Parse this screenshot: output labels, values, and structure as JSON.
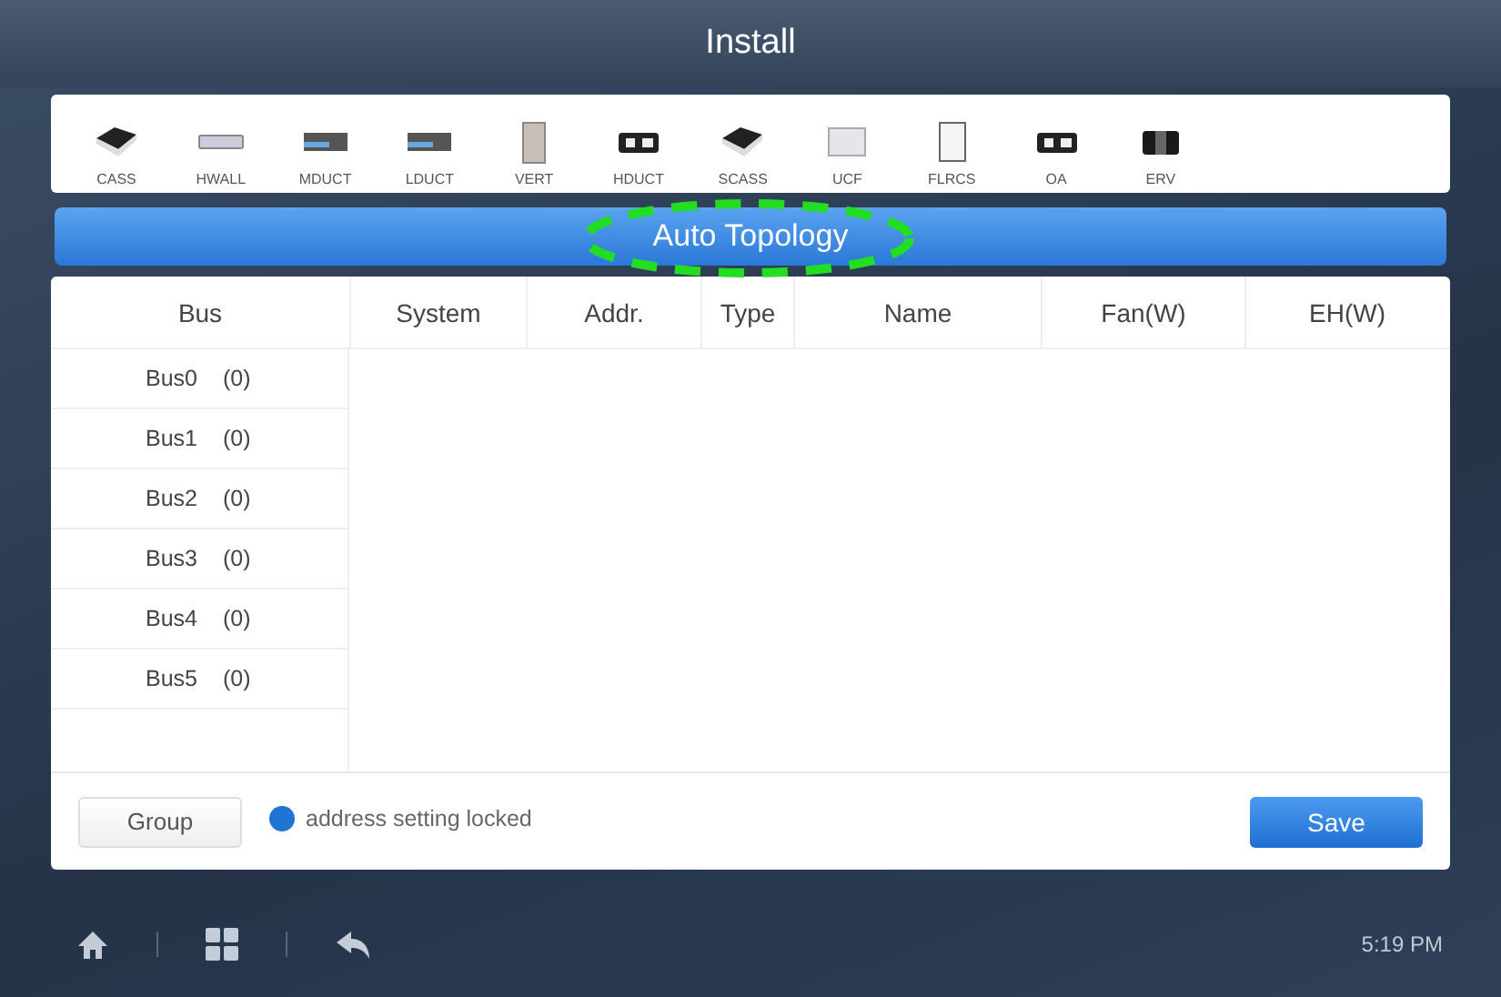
{
  "window": {
    "title": "Install"
  },
  "units": [
    {
      "label": "CASS",
      "kind": "cassette"
    },
    {
      "label": "HWALL",
      "kind": "wall"
    },
    {
      "label": "MDUCT",
      "kind": "duct"
    },
    {
      "label": "LDUCT",
      "kind": "duct"
    },
    {
      "label": "VERT",
      "kind": "cabinet"
    },
    {
      "label": "HDUCT",
      "kind": "box"
    },
    {
      "label": "SCASS",
      "kind": "cassette"
    },
    {
      "label": "UCF",
      "kind": "panel"
    },
    {
      "label": "FLRCS",
      "kind": "tower"
    },
    {
      "label": "OA",
      "kind": "box"
    },
    {
      "label": "ERV",
      "kind": "block"
    }
  ],
  "banner": {
    "label": "Auto Topology"
  },
  "table": {
    "columns": [
      "Bus",
      "System",
      "Addr.",
      "Type",
      "Name",
      "Fan(W)",
      "EH(W)"
    ],
    "buses": [
      {
        "name": "Bus0",
        "count": "(0)"
      },
      {
        "name": "Bus1",
        "count": "(0)"
      },
      {
        "name": "Bus2",
        "count": "(0)"
      },
      {
        "name": "Bus3",
        "count": "(0)"
      },
      {
        "name": "Bus4",
        "count": "(0)"
      },
      {
        "name": "Bus5",
        "count": "(0)"
      }
    ]
  },
  "footer": {
    "group_button": "Group",
    "status": {
      "label": "address setting locked",
      "locked": true
    },
    "save_button": "Save"
  },
  "status_bar": {
    "time": "5:19 PM"
  }
}
